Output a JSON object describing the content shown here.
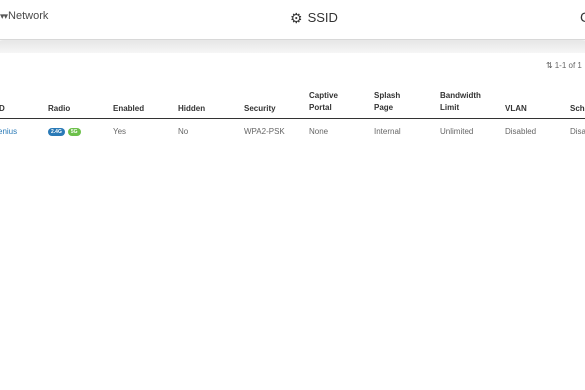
{
  "header": {
    "network_label": "Network",
    "network_icon": "network-icon",
    "title": "SSID",
    "title_icon": "gear-icon",
    "right_glyph": "C"
  },
  "pager": {
    "sort_icon": "sort-icon",
    "text": "1-1 of 1"
  },
  "table": {
    "columns": {
      "name": "D",
      "radio": "Radio",
      "enabled": "Enabled",
      "hidden": "Hidden",
      "security": "Security",
      "captive_portal": "Captive\nPortal",
      "splash_page": "Splash\nPage",
      "bandwidth_limit": "Bandwidth\nLimit",
      "vlan": "VLAN",
      "schedule": "Sch"
    },
    "rows": [
      {
        "name": "enius",
        "radio_badges": {
          "b24": "2.4G",
          "b5": "5G"
        },
        "enabled": "Yes",
        "hidden": "No",
        "security": "WPA2-PSK",
        "captive_portal": "None",
        "splash_page": "Internal",
        "bandwidth_limit": "Unlimited",
        "vlan": "Disabled",
        "schedule": "Disa"
      }
    ]
  },
  "colors": {
    "link": "#2a7ab7",
    "badge_24g": "#2a7ab7",
    "badge_5g": "#6cc04a"
  }
}
